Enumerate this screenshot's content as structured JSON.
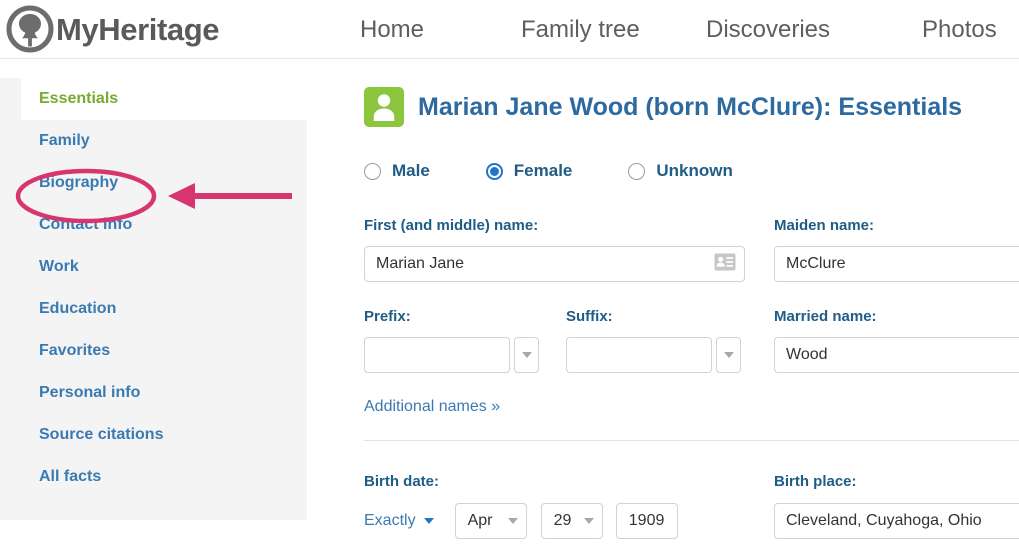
{
  "brand": {
    "name": "MyHeritage",
    "logo_icon": "tree-in-circle-icon",
    "logo_color": "#5a5a5a"
  },
  "nav": {
    "items": [
      {
        "label": "Home",
        "name": "nav-home"
      },
      {
        "label": "Family tree",
        "name": "nav-family-tree"
      },
      {
        "label": "Discoveries",
        "name": "nav-discoveries"
      },
      {
        "label": "Photos",
        "name": "nav-photos"
      }
    ]
  },
  "sidebar": {
    "active_item": {
      "label": "Essentials",
      "color": "#76ab2f"
    },
    "items": [
      {
        "label": "Family"
      },
      {
        "label": "Biography"
      },
      {
        "label": "Contact info"
      },
      {
        "label": "Work"
      },
      {
        "label": "Education"
      },
      {
        "label": "Favorites"
      },
      {
        "label": "Personal info"
      },
      {
        "label": "Source citations"
      },
      {
        "label": "All facts"
      }
    ],
    "link_color": "#3a7ab3"
  },
  "annotation": {
    "color": "#d6356f",
    "ellipse_target": "Biography",
    "arrow_direction": "left"
  },
  "main": {
    "avatar_icon": "person-avatar-icon",
    "avatar_color": "#8cc63e",
    "title": "Marian Jane Wood (born McClure): Essentials",
    "gender": {
      "options": [
        {
          "label": "Male",
          "selected": false
        },
        {
          "label": "Female",
          "selected": true
        },
        {
          "label": "Unknown",
          "selected": false
        }
      ],
      "selected_color": "#2176c7"
    },
    "fields": {
      "first_name": {
        "label": "First (and middle) name:",
        "value": "Marian Jane",
        "placeholder": "",
        "trailing_icon": "contact-card-icon"
      },
      "maiden_name": {
        "label": "Maiden name:",
        "value": "McClure",
        "placeholder": ""
      },
      "prefix": {
        "label": "Prefix:",
        "value": "",
        "placeholder": ""
      },
      "suffix": {
        "label": "Suffix:",
        "value": "",
        "placeholder": ""
      },
      "married_name": {
        "label": "Married name:",
        "value": "Wood",
        "placeholder": ""
      },
      "additional_names_link": "Additional names »",
      "birth_date": {
        "label": "Birth date:",
        "qualifier": "Exactly",
        "month": "Apr",
        "day": "29",
        "year": "1909"
      },
      "birth_place": {
        "label": "Birth place:",
        "value": "Cleveland, Cuyahoga, Ohio",
        "placeholder": ""
      }
    }
  }
}
